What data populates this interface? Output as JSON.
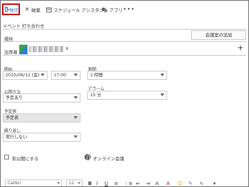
{
  "toolbar": {
    "send_label": "送信",
    "discard_label": "破棄",
    "assistant_label": "スケジュール アシスタント",
    "apps_label": "アプリ",
    "more_label": "•••"
  },
  "event": {
    "subject": "イベント 打ち合わせ",
    "location_label": "場所",
    "add_room_label": "会議室の追加",
    "attendees_label": "出席者",
    "remove_glyph": "×",
    "add_glyph": "+"
  },
  "schedule": {
    "start_label": "開始",
    "start_date": "2015/06/12 (金)",
    "start_time": "17:00",
    "duration_label": "期間",
    "duration_value": "1 時間",
    "show_as_label": "公開方法",
    "show_as_value": "予定あり",
    "alarm_label": "アラーム",
    "alarm_value": "15 分",
    "calendar_label": "予定表",
    "calendar_value": "予定表",
    "repeat_label": "繰り返し",
    "repeat_value": "実行しない",
    "private_label": "非公開にする",
    "online_meeting_label": "オンライン会議"
  },
  "format": {
    "font_value": "Calibri",
    "size_value": "12",
    "buttons": [
      "B",
      "I",
      "U",
      "≡",
      "⋮≡",
      "⇤",
      "⇥",
      "A",
      "A",
      "☺",
      "✎",
      "∿",
      "▾"
    ]
  },
  "colors": {
    "highlight_border": "#d00000",
    "accent": "#2a6ebb"
  }
}
